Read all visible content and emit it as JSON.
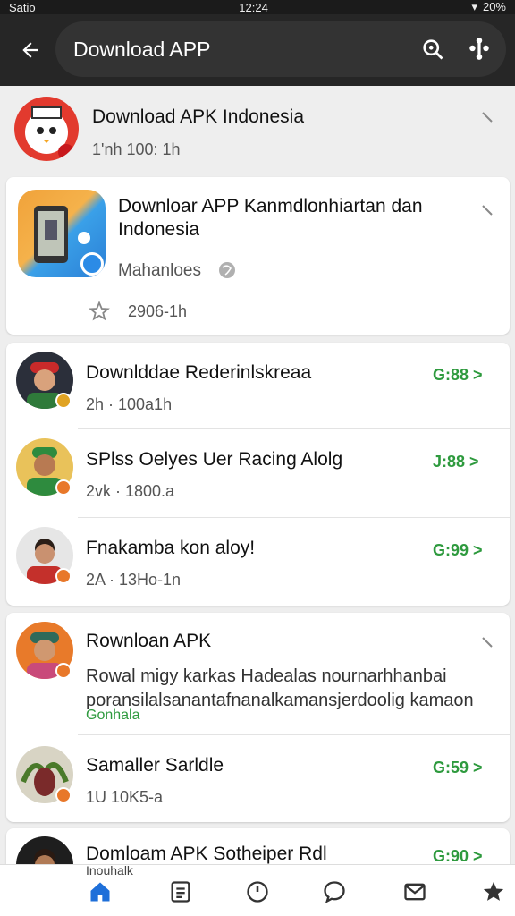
{
  "status_bar": {
    "carrier": "Satio",
    "time": "12:24",
    "battery": "20%"
  },
  "app_bar": {
    "title": "Download APP"
  },
  "header_item": {
    "title": "Download APK Indonesia",
    "meta": "1'nh 100: 1h"
  },
  "featured_card": {
    "title": "Downloar APP Kanmdlonhiartan dan Indonesia",
    "source": "Mahanloes",
    "meta": "2906-1h"
  },
  "group1": [
    {
      "title": "Downlddae Rederinlskreaa",
      "meta": "2h · 100a1h",
      "count": "G:88 >"
    },
    {
      "title": "SPlss Oelyes Uer Racing Alolg",
      "meta": "2vk · 1800.a",
      "count": "J:88 >"
    },
    {
      "title": "Fnakamba kon aloy!",
      "meta": "2A · 13Ho-1n",
      "count": "G:99 >"
    }
  ],
  "group2": {
    "item": {
      "title": "Rownloan APK",
      "body": "Rowal migy karkas Hadealas nournarhhanbai poransilalsanantafnanalkamansjerdoolig kamaon",
      "link": "Gonhala"
    },
    "row2": {
      "title": "Samaller Sarldle",
      "meta": "1U 10K5-a",
      "count": "G:59 >"
    }
  },
  "group3": {
    "title": "Domloam APK Sotheiper Rdl",
    "meta": "Inouhalk",
    "count": "G:90 >"
  },
  "nav": [
    "home-icon",
    "feed-icon",
    "clock-icon",
    "chat-icon",
    "mail-icon",
    "star-icon"
  ],
  "colors": {
    "accent_green": "#2e9a3e",
    "appbar": "#262626",
    "badge": "#e8782a",
    "nav_active": "#1e6fd9"
  }
}
